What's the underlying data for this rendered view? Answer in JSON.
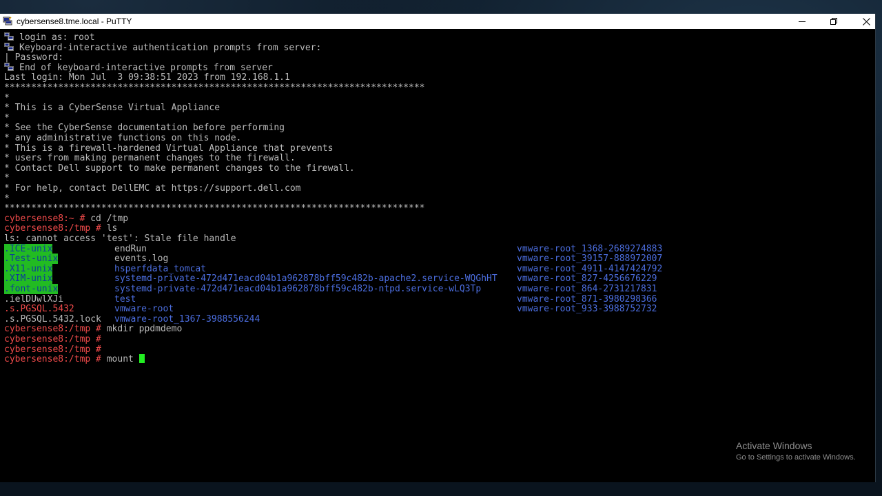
{
  "window": {
    "title": "cybersense8.tme.local - PuTTY",
    "controls": {
      "minimize": "minimize-icon",
      "restore": "restore-icon",
      "close": "close-icon"
    }
  },
  "terminal": {
    "colors": {
      "text": "#bbbbbb",
      "prompt": "#ef4a4a",
      "highlight_bg": "#22bb22",
      "directory": "#4c6ee0",
      "cursor": "#22ee22"
    },
    "lines": [
      {
        "icon": "putty-auth-icon",
        "text": "login as: root"
      },
      {
        "icon": "putty-auth-icon",
        "text": "Keyboard-interactive authentication prompts from server:"
      },
      {
        "text": "| Password:"
      },
      {
        "icon": "putty-auth-icon",
        "text": "End of keyboard-interactive prompts from server"
      },
      {
        "text": "Last login: Mon Jul  3 09:38:51 2023 from 192.168.1.1"
      },
      {
        "text": "******************************************************************************"
      },
      {
        "text": "*"
      },
      {
        "text": "* This is a CyberSense Virtual Appliance"
      },
      {
        "text": "*"
      },
      {
        "text": "* See the CyberSense documentation before performing"
      },
      {
        "text": "* any administrative functions on this node."
      },
      {
        "text": "* This is a firewall-hardened Virtual Appliance that prevents"
      },
      {
        "text": "* users from making permanent changes to the firewall."
      },
      {
        "text": "* Contact Dell support to make permanent changes to the firewall."
      },
      {
        "text": "*"
      },
      {
        "text": "* For help, contact DellEMC at https://support.dell.com"
      },
      {
        "text": "*"
      },
      {
        "text": "******************************************************************************"
      },
      {
        "prompt": "cybersense8:~ #",
        "cmd": " cd /tmp"
      },
      {
        "prompt": "cybersense8:/tmp #",
        "cmd": " ls"
      },
      {
        "text": "ls: cannot access 'test': Stale file handle"
      },
      {
        "cols": [
          {
            "text": ".ICE-unix",
            "style": "hl"
          },
          {
            "text": "endRun",
            "style": "plain"
          },
          {
            "text": "vmware-root_1368-2689274883",
            "style": "dir"
          }
        ]
      },
      {
        "cols": [
          {
            "text": ".Test-unix",
            "style": "hl"
          },
          {
            "text": "events.log",
            "style": "plain"
          },
          {
            "text": "vmware-root_39157-888972007",
            "style": "dir"
          }
        ]
      },
      {
        "cols": [
          {
            "text": ".X11-unix",
            "style": "hl"
          },
          {
            "text": "hsperfdata_tomcat",
            "style": "dir"
          },
          {
            "text": "vmware-root_4911-4147424792",
            "style": "dir"
          }
        ]
      },
      {
        "cols": [
          {
            "text": ".XIM-unix",
            "style": "hl"
          },
          {
            "text": "systemd-private-472d471eacd04b1a962878bff59c482b-apache2.service-WQGhHT",
            "style": "dir"
          },
          {
            "text": "vmware-root_827-4256676229",
            "style": "dir"
          }
        ]
      },
      {
        "cols": [
          {
            "text": ".font-unix",
            "style": "hl"
          },
          {
            "text": "systemd-private-472d471eacd04b1a962878bff59c482b-ntpd.service-wLQ3Tp",
            "style": "dir"
          },
          {
            "text": "vmware-root_864-2731217831",
            "style": "dir"
          }
        ]
      },
      {
        "cols": [
          {
            "text": ".ielDUwlXJi",
            "style": "plain"
          },
          {
            "text": "test",
            "style": "dir"
          },
          {
            "text": "vmware-root_871-3980298366",
            "style": "dir"
          }
        ]
      },
      {
        "cols": [
          {
            "text": ".s.PGSQL.5432",
            "style": "red"
          },
          {
            "text": "vmware-root",
            "style": "dir"
          },
          {
            "text": "vmware-root_933-3988752732",
            "style": "dir"
          }
        ]
      },
      {
        "cols": [
          {
            "text": ".s.PGSQL.5432.lock",
            "style": "plain"
          },
          {
            "text": "vmware-root_1367-3988556244",
            "style": "dir"
          },
          {
            "text": "",
            "style": "plain"
          }
        ]
      },
      {
        "prompt": "cybersense8:/tmp #",
        "cmd": " mkdir ppdmdemo"
      },
      {
        "prompt": "cybersense8:/tmp #",
        "cmd": ""
      },
      {
        "prompt": "cybersense8:/tmp #",
        "cmd": ""
      },
      {
        "prompt": "cybersense8:/tmp #",
        "cmd": " mount ",
        "cursor": true
      }
    ]
  },
  "watermark": {
    "title": "Activate Windows",
    "subtitle": "Go to Settings to activate Windows."
  }
}
